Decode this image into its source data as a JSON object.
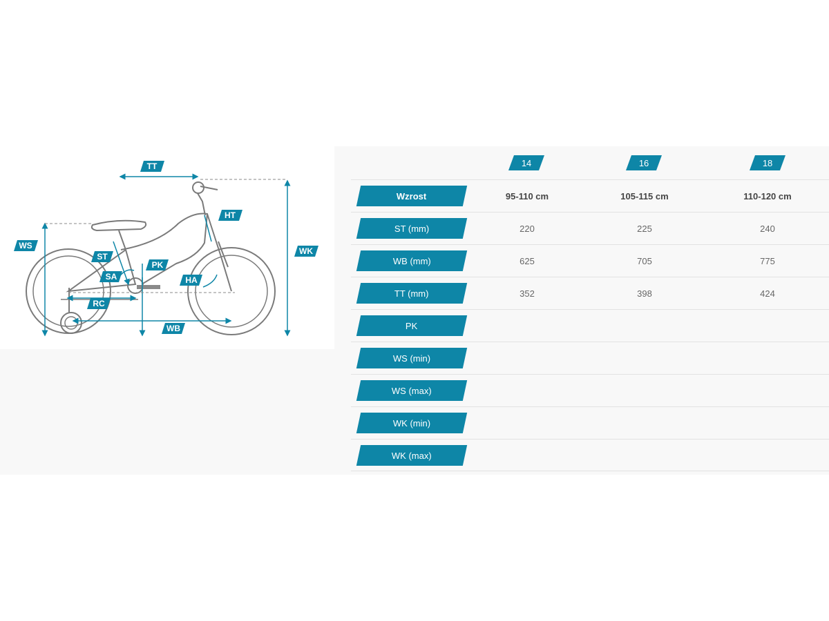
{
  "diagram": {
    "labels": {
      "tt": "TT",
      "ht": "HT",
      "ws": "WS",
      "wk": "WK",
      "st": "ST",
      "pk": "PK",
      "sa": "SA",
      "ha": "HA",
      "rc": "RC",
      "wb": "WB"
    },
    "colors": {
      "accent": "#0e86a7",
      "frame": "#7a7a7a"
    }
  },
  "table": {
    "sizes": [
      "14",
      "16",
      "18"
    ],
    "rows": [
      {
        "label": "Wzrost",
        "values": [
          "95-110 cm",
          "105-115 cm",
          "110-120 cm"
        ],
        "bold": true
      },
      {
        "label": "ST (mm)",
        "values": [
          "220",
          "225",
          "240"
        ]
      },
      {
        "label": "WB (mm)",
        "values": [
          "625",
          "705",
          "775"
        ]
      },
      {
        "label": "TT (mm)",
        "values": [
          "352",
          "398",
          "424"
        ]
      },
      {
        "label": "PK",
        "values": [
          "",
          "",
          ""
        ]
      },
      {
        "label": "WS (min)",
        "values": [
          "",
          "",
          ""
        ]
      },
      {
        "label": "WS (max)",
        "values": [
          "",
          "",
          ""
        ]
      },
      {
        "label": "WK (min)",
        "values": [
          "",
          "",
          ""
        ]
      },
      {
        "label": "WK (max)",
        "values": [
          "",
          "",
          ""
        ]
      }
    ]
  }
}
